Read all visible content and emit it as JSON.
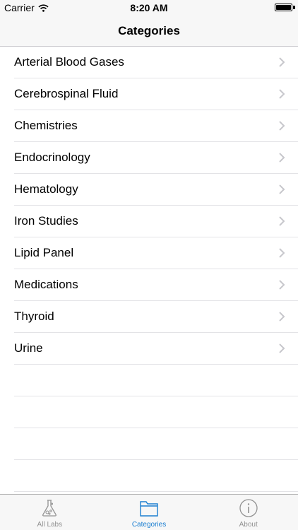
{
  "status_bar": {
    "carrier": "Carrier",
    "time": "8:20 AM"
  },
  "nav": {
    "title": "Categories"
  },
  "categories": [
    {
      "label": "Arterial Blood Gases"
    },
    {
      "label": "Cerebrospinal Fluid"
    },
    {
      "label": "Chemistries"
    },
    {
      "label": "Endocrinology"
    },
    {
      "label": "Hematology"
    },
    {
      "label": "Iron Studies"
    },
    {
      "label": "Lipid Panel"
    },
    {
      "label": "Medications"
    },
    {
      "label": "Thyroid"
    },
    {
      "label": "Urine"
    }
  ],
  "tabs": [
    {
      "label": "All Labs",
      "icon": "flask-icon",
      "active": false
    },
    {
      "label": "Categories",
      "icon": "folder-icon",
      "active": true
    },
    {
      "label": "About",
      "icon": "info-icon",
      "active": false
    }
  ],
  "colors": {
    "accent": "#1b7fd1",
    "inactive": "#929292",
    "bar_background": "#f7f7f7"
  }
}
